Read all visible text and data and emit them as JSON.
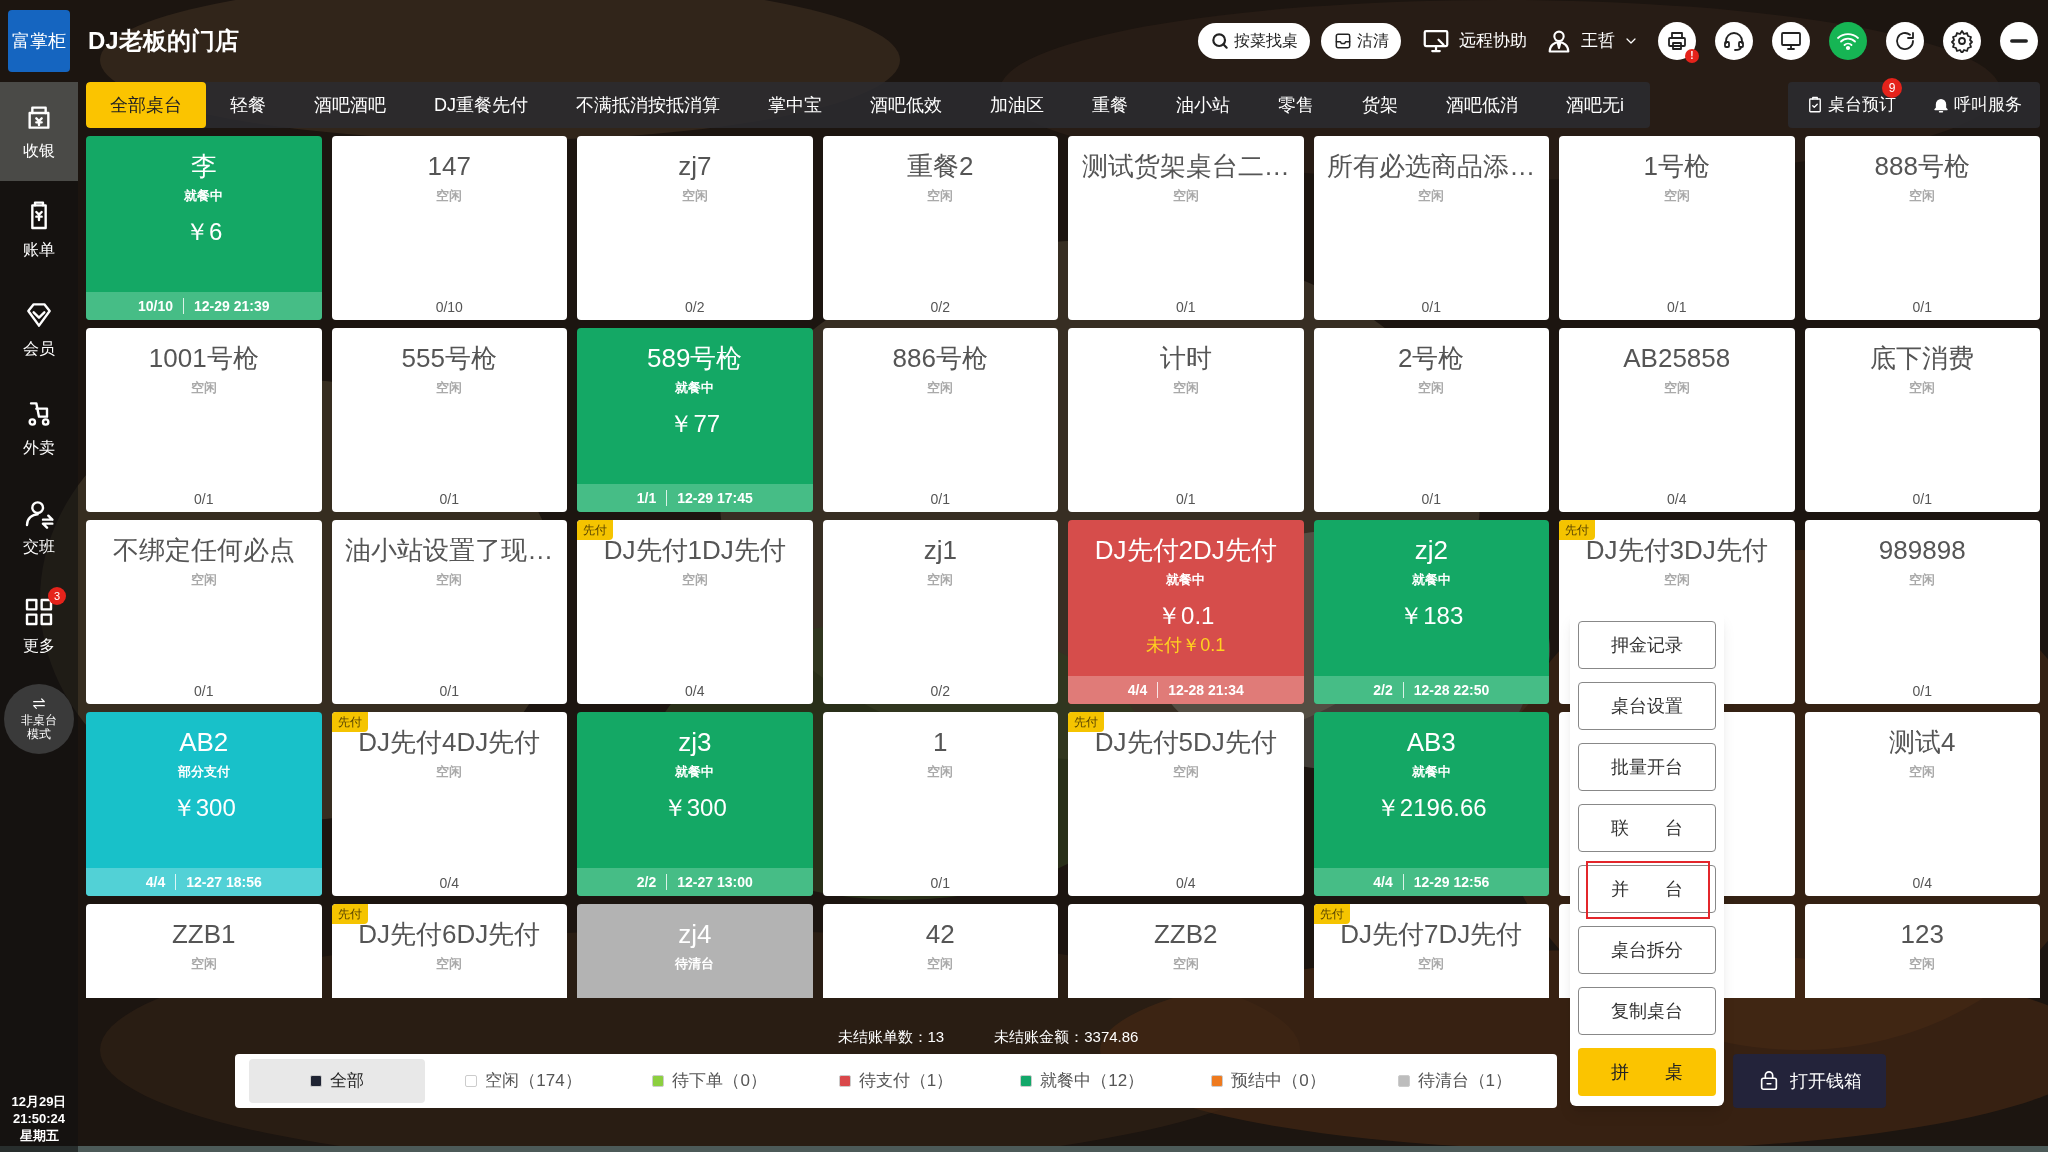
{
  "store": {
    "logo": "富掌柜",
    "name": "DJ老板的门店"
  },
  "toolbar": {
    "find_button": "按菜找桌",
    "soldout_button": "沽清",
    "remote": "远程协助",
    "user": "王哲",
    "printer_alert": "!"
  },
  "sidebar": {
    "items": [
      {
        "label": "收银",
        "selected": true
      },
      {
        "label": "账单",
        "selected": false
      },
      {
        "label": "会员",
        "selected": false
      },
      {
        "label": "外卖",
        "selected": false
      },
      {
        "label": "交班",
        "selected": false
      },
      {
        "label": "更多",
        "selected": false,
        "badge": "3"
      }
    ],
    "mode_button": "非桌台模式"
  },
  "clock": {
    "date": "12月29日",
    "time": "21:50:24",
    "weekday": "星期五"
  },
  "areas": [
    {
      "label": "全部桌台",
      "selected": true
    },
    {
      "label": "轻餐",
      "selected": false
    },
    {
      "label": "酒吧酒吧",
      "selected": false
    },
    {
      "label": "DJ重餐先付",
      "selected": false
    },
    {
      "label": "不满抵消按抵消算",
      "selected": false
    },
    {
      "label": "掌中宝",
      "selected": false
    },
    {
      "label": "酒吧低效",
      "selected": false
    },
    {
      "label": "加油区",
      "selected": false
    },
    {
      "label": "重餐",
      "selected": false
    },
    {
      "label": "油小站",
      "selected": false
    },
    {
      "label": "零售",
      "selected": false
    },
    {
      "label": "货架",
      "selected": false
    },
    {
      "label": "酒吧低消",
      "selected": false
    },
    {
      "label": "酒吧无i",
      "selected": false
    }
  ],
  "right_actions": [
    {
      "kind": "reserve",
      "label": "桌台预订",
      "badge": "9"
    },
    {
      "kind": "call",
      "label": "呼叫服务"
    }
  ],
  "tables": [
    {
      "kind": "dining",
      "name": "李",
      "status": "就餐中",
      "amount": "￥6",
      "seats": "10/10",
      "time": "12-29 21:39"
    },
    {
      "kind": "idle",
      "name": "147",
      "status": "空闲",
      "seats": "0/10"
    },
    {
      "kind": "idle",
      "name": "zj7",
      "status": "空闲",
      "seats": "0/2"
    },
    {
      "kind": "idle",
      "name": "重餐2",
      "status": "空闲",
      "seats": "0/2"
    },
    {
      "kind": "idle",
      "name": "测试货架桌台二…",
      "status": "空闲",
      "seats": "0/1"
    },
    {
      "kind": "idle",
      "name": "所有必选商品添…",
      "status": "空闲",
      "seats": "0/1"
    },
    {
      "kind": "idle",
      "name": "1号枪",
      "status": "空闲",
      "seats": "0/1"
    },
    {
      "kind": "idle",
      "name": "888号枪",
      "status": "空闲",
      "seats": "0/1"
    },
    {
      "kind": "idle",
      "name": "1001号枪",
      "status": "空闲",
      "seats": "0/1"
    },
    {
      "kind": "idle",
      "name": "555号枪",
      "status": "空闲",
      "seats": "0/1"
    },
    {
      "kind": "dining",
      "name": "589号枪",
      "status": "就餐中",
      "amount": "￥77",
      "seats": "1/1",
      "time": "12-29 17:45"
    },
    {
      "kind": "idle",
      "name": "886号枪",
      "status": "空闲",
      "seats": "0/1"
    },
    {
      "kind": "idle",
      "name": "计时",
      "status": "空闲",
      "seats": "0/1"
    },
    {
      "kind": "idle",
      "name": "2号枪",
      "status": "空闲",
      "seats": "0/1"
    },
    {
      "kind": "idle",
      "name": "AB25858",
      "status": "空闲",
      "seats": "0/4"
    },
    {
      "kind": "idle",
      "name": "底下消费",
      "status": "空闲",
      "seats": "0/1"
    },
    {
      "kind": "idle",
      "name": "不绑定任何必点",
      "status": "空闲",
      "seats": "0/1"
    },
    {
      "kind": "idle",
      "name": "油小站设置了现…",
      "status": "空闲",
      "seats": "0/1"
    },
    {
      "kind": "idle",
      "name": "DJ先付1DJ先付",
      "status": "空闲",
      "seats": "0/4",
      "badge": "先付"
    },
    {
      "kind": "idle",
      "name": "zj1",
      "status": "空闲",
      "seats": "0/2"
    },
    {
      "kind": "unpaid",
      "name": "DJ先付2DJ先付",
      "status": "就餐中",
      "amount": "￥0.1",
      "unpaid": "未付￥0.1",
      "seats": "4/4",
      "time": "12-28 21:34"
    },
    {
      "kind": "dining",
      "name": "zj2",
      "status": "就餐中",
      "amount": "￥183",
      "seats": "2/2",
      "time": "12-28 22:50"
    },
    {
      "kind": "idle",
      "name": "DJ先付3DJ先付",
      "status": "空闲",
      "badge": "先付"
    },
    {
      "kind": "idle",
      "name": "989898",
      "status": "空闲",
      "seats": "0/1"
    },
    {
      "kind": "partial",
      "name": "AB2",
      "status": "部分支付",
      "amount": "￥300",
      "seats": "4/4",
      "time": "12-27 18:56"
    },
    {
      "kind": "idle",
      "name": "DJ先付4DJ先付",
      "status": "空闲",
      "seats": "0/4",
      "badge": "先付"
    },
    {
      "kind": "dining",
      "name": "zj3",
      "status": "就餐中",
      "amount": "￥300",
      "seats": "2/2",
      "time": "12-27 13:00"
    },
    {
      "kind": "idle",
      "name": "1",
      "status": "空闲",
      "seats": "0/1"
    },
    {
      "kind": "idle",
      "name": "DJ先付5DJ先付",
      "status": "空闲",
      "seats": "0/4",
      "badge": "先付"
    },
    {
      "kind": "dining",
      "name": "AB3",
      "status": "就餐中",
      "amount": "￥2196.66",
      "seats": "4/4",
      "time": "12-29 12:56"
    },
    {
      "kind": "covered"
    },
    {
      "kind": "idle",
      "name": "测试4",
      "status": "空闲",
      "seats": "0/4"
    },
    {
      "kind": "idle",
      "name": "ZZB1",
      "status": "空闲"
    },
    {
      "kind": "idle",
      "name": "DJ先付6DJ先付",
      "status": "空闲",
      "badge": "先付"
    },
    {
      "kind": "clearing",
      "name": "zj4",
      "status": "待清台"
    },
    {
      "kind": "idle",
      "name": "42",
      "status": "空闲"
    },
    {
      "kind": "idle",
      "name": "ZZB2",
      "status": "空闲"
    },
    {
      "kind": "idle",
      "name": "DJ先付7DJ先付",
      "status": "空闲",
      "badge": "先付"
    },
    {
      "kind": "covered"
    },
    {
      "kind": "idle",
      "name": "123",
      "status": "空闲"
    }
  ],
  "context_menu": [
    {
      "kind": "normal",
      "label": "押金记录",
      "highlighted": false
    },
    {
      "kind": "normal",
      "label": "桌台设置",
      "highlighted": false
    },
    {
      "kind": "normal",
      "label": "批量开台",
      "highlighted": false
    },
    {
      "kind": "normal",
      "label": "联台",
      "highlighted": false
    },
    {
      "kind": "normal",
      "label": "并台",
      "highlighted": true
    },
    {
      "kind": "normal",
      "label": "桌台拆分",
      "highlighted": false
    },
    {
      "kind": "normal",
      "label": "复制桌台",
      "highlighted": false
    },
    {
      "kind": "primary",
      "label": "拼桌",
      "highlighted": false
    }
  ],
  "summary": {
    "unpaid_bills": "未结账单数：13",
    "unpaid_amount": "未结账金额：3374.86"
  },
  "filters": [
    {
      "label": "全部",
      "selected": true,
      "color": "#1f2433"
    },
    {
      "label": "空闲（174）",
      "selected": false,
      "color": "#ffffff"
    },
    {
      "label": "待下单（0）",
      "selected": false,
      "color": "#8ccf3f"
    },
    {
      "label": "待支付（1）",
      "selected": false,
      "color": "#d9484b"
    },
    {
      "label": "就餐中（12）",
      "selected": false,
      "color": "#13a86a"
    },
    {
      "label": "预结中（0）",
      "selected": false,
      "color": "#ee7a1f"
    },
    {
      "label": "待清台（1）",
      "selected": false,
      "color": "#bdbdbd"
    }
  ],
  "cash_drawer": "打开钱箱"
}
